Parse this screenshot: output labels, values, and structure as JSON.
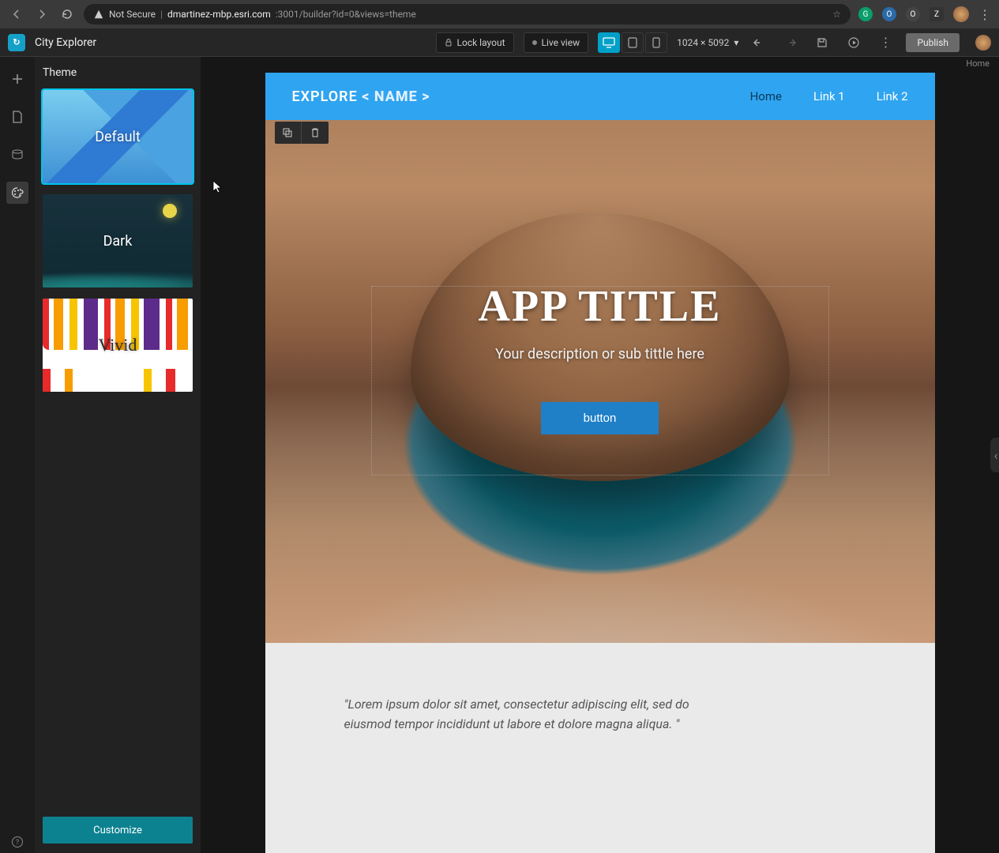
{
  "browser": {
    "security_label": "Not Secure",
    "url_prefix": "dmartinez-mbp.esri.com",
    "url_path": ":3001/builder?id=0&views=theme",
    "extensions": [
      "G",
      "O",
      "O",
      "Z"
    ]
  },
  "app": {
    "name": "City Explorer",
    "lock_layout": "Lock layout",
    "live_view": "Live view",
    "size_label": "1024 × 5092",
    "publish": "Publish"
  },
  "panel": {
    "title": "Theme",
    "themes": [
      {
        "name": "Default",
        "selected": true
      },
      {
        "name": "Dark",
        "selected": false
      },
      {
        "name": "Vivid",
        "selected": false
      }
    ],
    "customize": "Customize"
  },
  "canvas": {
    "page_label": "Home",
    "header": {
      "brand_prefix": "EXPLORE ",
      "brand_name": "< NAME >",
      "nav": [
        {
          "label": "Home",
          "active": true
        },
        {
          "label": "Link 1",
          "active": false
        },
        {
          "label": "Link 2",
          "active": false
        }
      ]
    },
    "hero": {
      "title": "APP TITLE",
      "subtitle": "Your description or sub tittle here",
      "button": "button"
    },
    "quote": "\"Lorem ipsum dolor sit amet, consectetur adipiscing elit, sed do eiusmod tempor incididunt ut labore et dolore magna aliqua. \""
  }
}
